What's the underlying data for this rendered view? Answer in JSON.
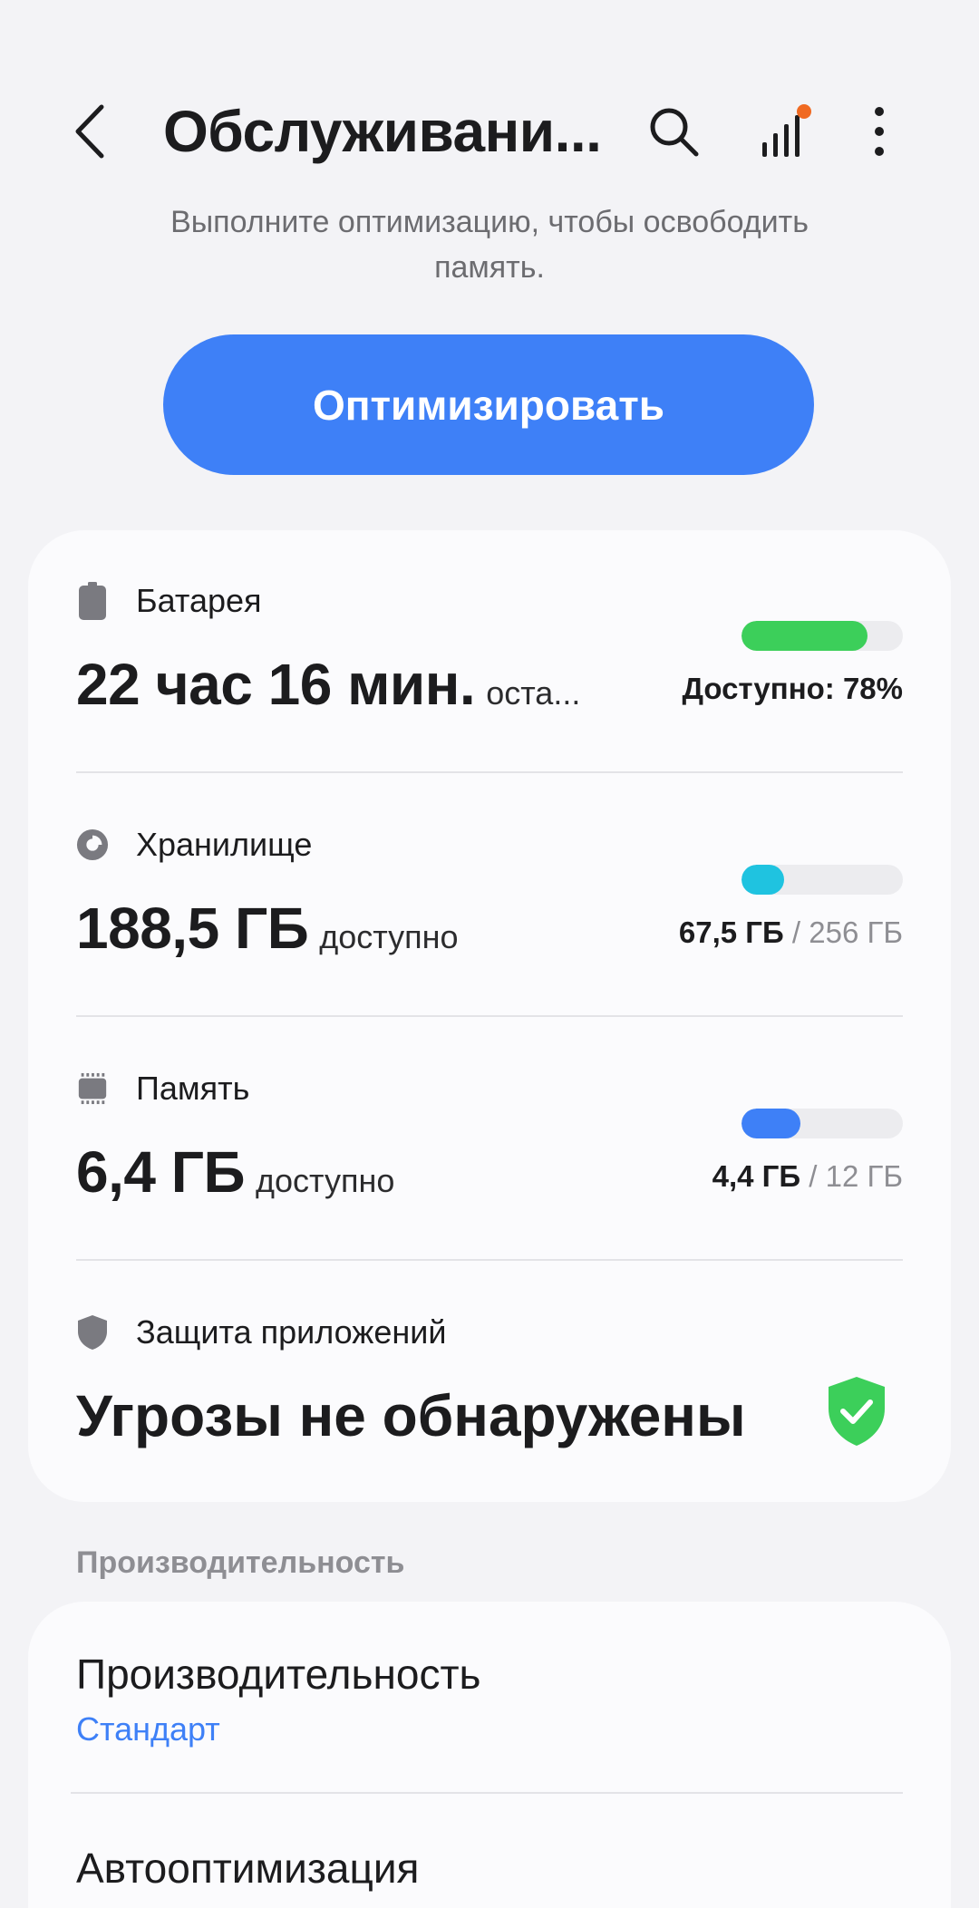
{
  "header": {
    "title": "Обслуживани..."
  },
  "intro": {
    "line1": "Выполните оптимизацию, чтобы освободить",
    "line2": "память."
  },
  "optimize_button": "Оптимизировать",
  "battery": {
    "label": "Батарея",
    "value": "22 час 16 мин.",
    "suffix": "оста...",
    "caption": "Доступно: 78%",
    "level": 0.78,
    "color": "#3ccf5a"
  },
  "storage": {
    "label": "Хранилище",
    "value": "188,5 ГБ",
    "suffix": "доступно",
    "used": "67,5 ГБ",
    "total": "/ 256 ГБ",
    "level": 0.264,
    "color": "#1fc3e0"
  },
  "memory": {
    "label": "Память",
    "value": "6,4 ГБ",
    "suffix": "доступно",
    "used": "4,4 ГБ",
    "total": "/ 12 ГБ",
    "level": 0.367,
    "color": "#3e80f7"
  },
  "protection": {
    "label": "Защита приложений",
    "status": "Угрозы не обнаружены",
    "color": "#3ccf5a"
  },
  "performance_section": {
    "title": "Производительность",
    "items": [
      {
        "title": "Производительность",
        "subtitle": "Стандарт"
      },
      {
        "title": "Автооптимизация"
      }
    ]
  },
  "colors": {
    "accent": "#3e80f7",
    "badge": "#f06a22"
  }
}
